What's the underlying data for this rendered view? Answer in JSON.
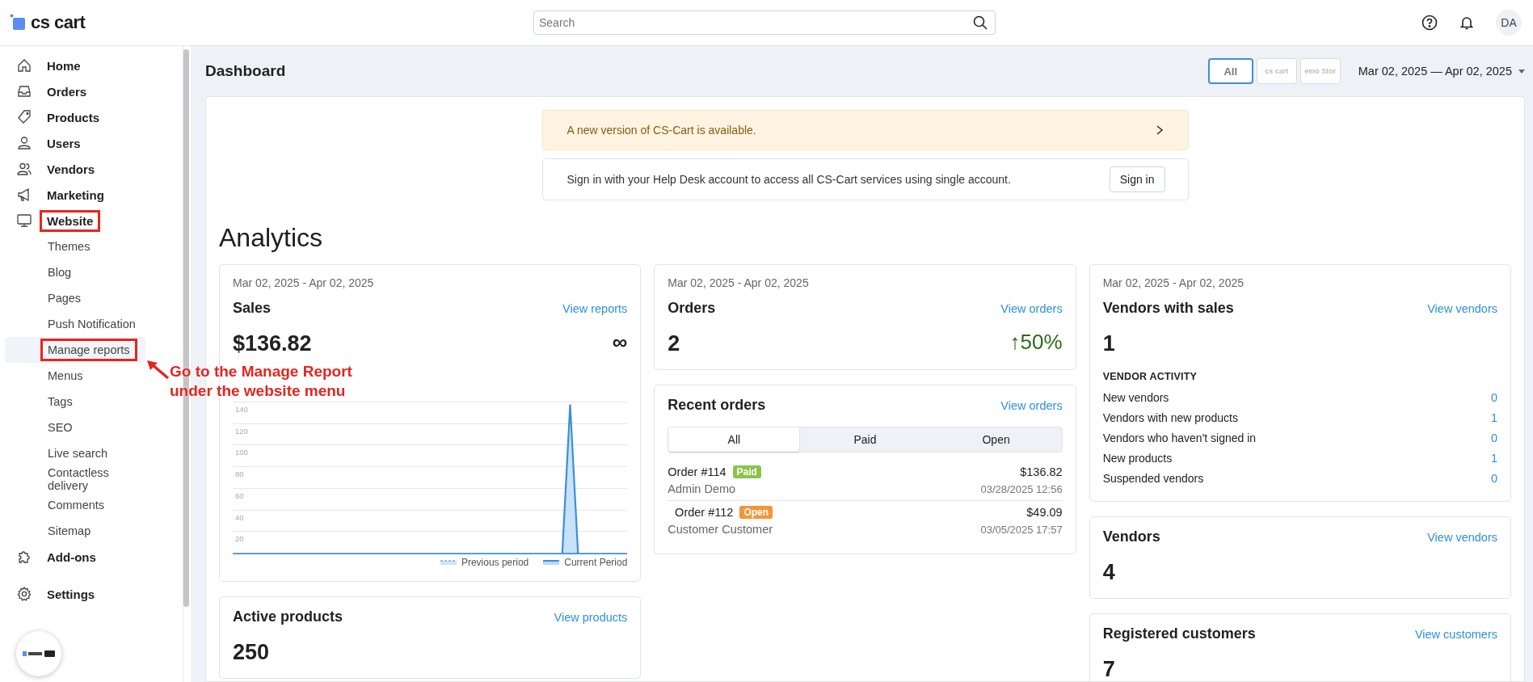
{
  "header": {
    "logo": "cs cart",
    "search": {
      "placeholder": "Search"
    },
    "avatar": "DA"
  },
  "sidebar": {
    "items": [
      {
        "label": "Home",
        "outlined": false
      },
      {
        "label": "Orders",
        "outlined": false
      },
      {
        "label": "Products",
        "outlined": false
      },
      {
        "label": "Users",
        "outlined": false
      },
      {
        "label": "Vendors",
        "outlined": false
      },
      {
        "label": "Marketing",
        "outlined": false
      },
      {
        "label": "Website",
        "outlined": true,
        "children": [
          {
            "label": "Themes",
            "selected": false,
            "outlined": false
          },
          {
            "label": "Blog",
            "selected": false,
            "outlined": false
          },
          {
            "label": "Pages",
            "selected": false,
            "outlined": false
          },
          {
            "label": "Push Notification",
            "selected": false,
            "outlined": false
          },
          {
            "label": "Manage reports",
            "selected": true,
            "outlined": true
          },
          {
            "label": "Menus",
            "selected": false,
            "outlined": false
          },
          {
            "label": "Tags",
            "selected": false,
            "outlined": false
          },
          {
            "label": "SEO",
            "selected": false,
            "outlined": false
          },
          {
            "label": "Live search",
            "selected": false,
            "outlined": false
          },
          {
            "label": "Contactless delivery",
            "selected": false,
            "outlined": false
          },
          {
            "label": "Comments",
            "selected": false,
            "outlined": false
          },
          {
            "label": "Sitemap",
            "selected": false,
            "outlined": false
          }
        ]
      },
      {
        "label": "Add-ons",
        "outlined": false
      },
      {
        "label": "Settings",
        "outlined": false
      }
    ]
  },
  "annotation": {
    "text": "Go to the Manage Report under the website menu"
  },
  "page": {
    "title": "Dashboard",
    "store_filters": [
      {
        "label": "All",
        "selected": true
      },
      {
        "label": "cs cart",
        "selected": false
      },
      {
        "label": "emo Stor",
        "selected": false
      }
    ],
    "date_range": "Mar 02, 2025 — Apr 02, 2025"
  },
  "notices": [
    {
      "kind": "update",
      "text": "A new version of CS-Cart is available."
    },
    {
      "kind": "signin",
      "text": "Sign in with your Help Desk account to access all CS-Cart services using single account.",
      "button": "Sign in"
    }
  ],
  "analytics": {
    "title": "Analytics",
    "sales": {
      "period": "Mar 02, 2025 - Apr 02, 2025",
      "title": "Sales",
      "link": "View reports",
      "value": "$136.82",
      "change": "∞",
      "chart": {
        "axis_labels": [
          "140",
          "120",
          "100",
          "80",
          "60",
          "40",
          "20"
        ],
        "legend": [
          {
            "kind": "dashed",
            "label": "Previous period"
          },
          {
            "kind": "solid",
            "label": "Current Period"
          }
        ]
      }
    },
    "active_products": {
      "title": "Active products",
      "link": "View products",
      "value": "250"
    },
    "orders": {
      "period": "Mar 02, 2025 - Apr 02, 2025",
      "title": "Orders",
      "link": "View orders",
      "value": "2",
      "change": "↑50%"
    },
    "recent_orders": {
      "title": "Recent orders",
      "link": "View orders",
      "tabs": [
        {
          "label": "All",
          "selected": true
        },
        {
          "label": "Paid",
          "selected": false
        },
        {
          "label": "Open",
          "selected": false
        }
      ],
      "rows": [
        {
          "order": "Order #114",
          "status": "Paid",
          "color": "#8bc34a",
          "customer": "Admin Demo",
          "total": "$136.82",
          "date": "03/28/2025 12:56"
        },
        {
          "order": "Order #112",
          "status": "Open",
          "color": "#f5953a",
          "customer": "Customer Customer",
          "total": "$49.09",
          "date": "03/05/2025 17:57"
        }
      ]
    },
    "vendors_with_sales": {
      "period": "Mar 02, 2025 - Apr 02, 2025",
      "title": "Vendors with sales",
      "link": "View vendors",
      "value": "1",
      "activity_title": "VENDOR ACTIVITY",
      "activity": [
        {
          "label": "New vendors",
          "value": "0"
        },
        {
          "label": "Vendors with new products",
          "value": "1"
        },
        {
          "label": "Vendors who haven't signed in",
          "value": "0"
        },
        {
          "label": "New products",
          "value": "1"
        },
        {
          "label": "Suspended vendors",
          "value": "0"
        }
      ]
    },
    "vendors": {
      "title": "Vendors",
      "link": "View vendors",
      "value": "4"
    },
    "registered_customers": {
      "title": "Registered customers",
      "link": "View customers",
      "value": "7"
    }
  }
}
